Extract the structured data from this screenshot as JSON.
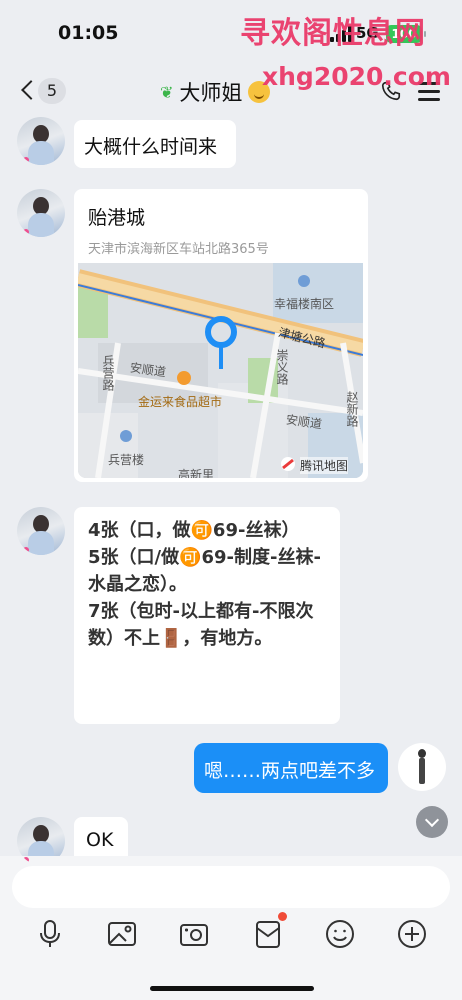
{
  "status": {
    "time": "01:05",
    "network": "5G",
    "battery": "100"
  },
  "watermark": {
    "line1": "寻欢阁性息网",
    "line2": "xhg2020.com"
  },
  "nav": {
    "unread_count": "5",
    "title": "大师姐"
  },
  "messages": {
    "m1": "大概什么时间来",
    "location_name": "贻港城",
    "location_address": "天津市滨海新区车站北路365号",
    "price_lines": [
      "4张（口，做🉑69-丝袜）",
      "5张（口/做🉑69-制度-丝袜-水晶之恋）。",
      "7张（包时-以上都有-不限次数）不上🚪，有地方。"
    ],
    "me": "嗯……两点吧差不多",
    "ok": "OK"
  },
  "map": {
    "labels": {
      "district1": "幸福楼南区",
      "road1": "津塘公路",
      "road2": "安顺道",
      "road3": "崇义路",
      "road4": "兵营路",
      "store": "金运来食品超市",
      "road5": "安顺道",
      "road6": "赵新路",
      "district2": "兵营楼",
      "district3": "高新里"
    },
    "provider": "腾讯地图"
  },
  "toolbar": {
    "icons": [
      "microphone-icon",
      "image-icon",
      "camera-icon",
      "red-packet-icon",
      "emoji-icon",
      "plus-icon"
    ]
  },
  "colors": {
    "bubble_mine": "#1b8ff7",
    "watermark": "#ea3a6a",
    "badge_dot": "#f04b37"
  }
}
